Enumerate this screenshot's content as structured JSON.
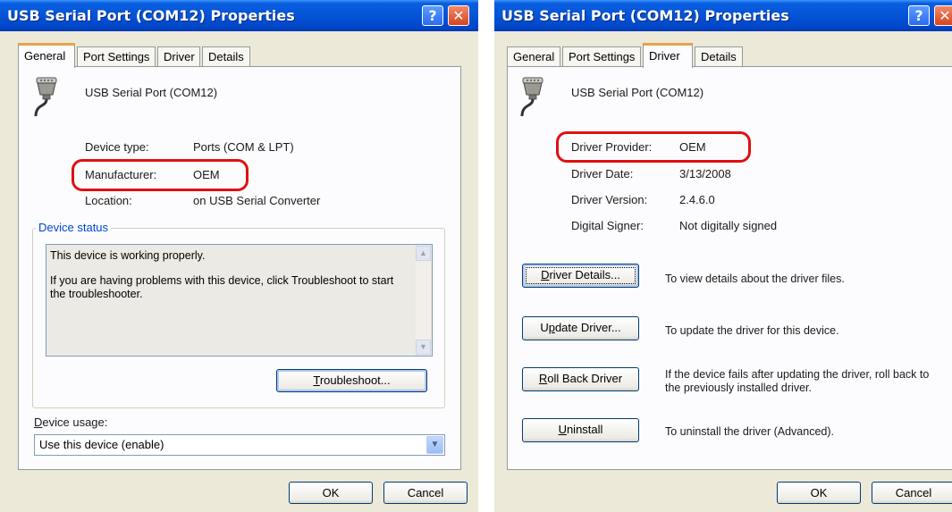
{
  "left": {
    "title": "USB Serial Port (COM12) Properties",
    "tabs": [
      "General",
      "Port Settings",
      "Driver",
      "Details"
    ],
    "device_name": "USB Serial Port (COM12)",
    "props": [
      {
        "label": "Device type:",
        "value": "Ports (COM & LPT)"
      },
      {
        "label": "Manufacturer:",
        "value": "OEM"
      },
      {
        "label": "Location:",
        "value": "on USB Serial Converter"
      }
    ],
    "status_group": "Device status",
    "status_line1": "This device is working properly.",
    "status_line2": "If you are having problems with this device, click Troubleshoot to start the troubleshooter.",
    "troubleshoot": {
      "mnemonic": "T",
      "rest": "roubleshoot..."
    },
    "usage_label": {
      "mnemonic": "D",
      "rest": "evice usage:"
    },
    "usage_value": "Use this device (enable)",
    "ok": "OK",
    "cancel": "Cancel"
  },
  "right": {
    "title": "USB Serial Port (COM12) Properties",
    "tabs": [
      "General",
      "Port Settings",
      "Driver",
      "Details"
    ],
    "device_name": "USB Serial Port (COM12)",
    "props": [
      {
        "label": "Driver Provider:",
        "value": "OEM"
      },
      {
        "label": "Driver Date:",
        "value": "3/13/2008"
      },
      {
        "label": "Driver Version:",
        "value": "2.4.6.0"
      },
      {
        "label": "Digital Signer:",
        "value": "Not digitally signed"
      }
    ],
    "actions": [
      {
        "mnemonic": "D",
        "rest": "river Details...",
        "desc": "To view details about the driver files."
      },
      {
        "pre": "U",
        "mnemonic": "p",
        "rest": "date Driver...",
        "desc": "To update the driver for this device."
      },
      {
        "mnemonic": "R",
        "rest": "oll Back Driver",
        "desc": "If the device fails after updating the driver, roll back to the previously installed driver."
      },
      {
        "mnemonic": "U",
        "rest": "ninstall",
        "desc": "To uninstall the driver (Advanced)."
      }
    ],
    "ok": "OK",
    "cancel": "Cancel"
  },
  "colors": {
    "highlight": "#e01010",
    "titlebar": "#0553d6",
    "group_title": "#0046d5"
  },
  "icons": [
    "help-icon",
    "close-icon",
    "serial-port-icon",
    "chevron-down-icon",
    "scroll-up-icon",
    "scroll-down-icon"
  ]
}
